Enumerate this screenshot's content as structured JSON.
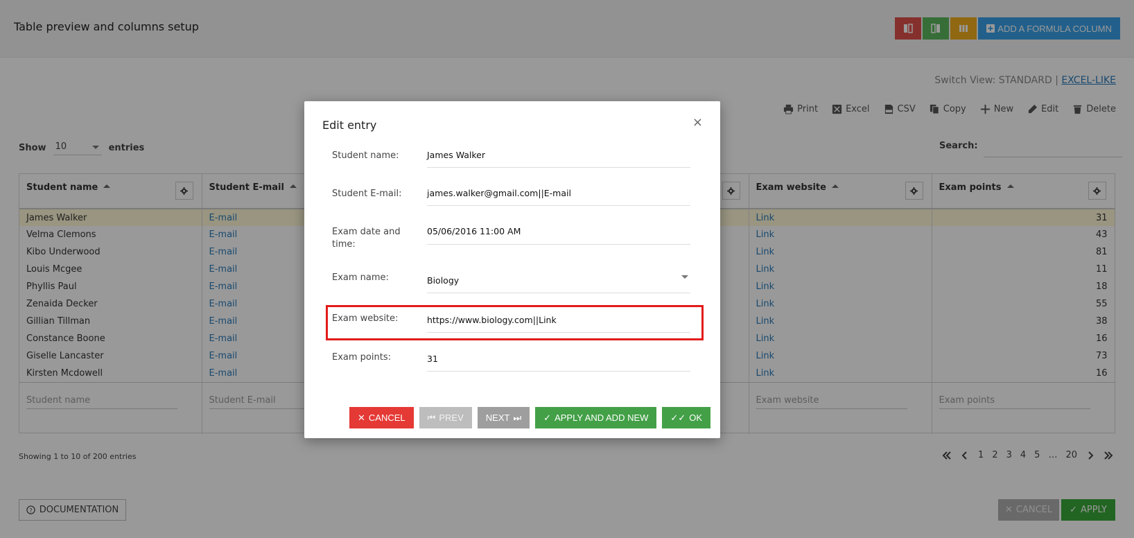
{
  "header": {
    "title": "Table preview and columns setup",
    "formula_button": "ADD A FORMULA COLUMN",
    "icons": [
      "column-remove-icon",
      "column-add-icon",
      "columns-icon",
      "plus-box-icon"
    ]
  },
  "switch_view": {
    "prefix": "Switch View: STANDARD |",
    "link": "EXCEL-LIKE"
  },
  "tools": {
    "print": "Print",
    "excel": "Excel",
    "csv": "CSV",
    "copy": "Copy",
    "new": "New",
    "edit": "Edit",
    "delete": "Delete"
  },
  "show": {
    "label": "Show",
    "value": "10",
    "suffix": "entries"
  },
  "search": {
    "label": "Search:"
  },
  "table": {
    "columns": [
      "Student name",
      "Student E-mail",
      "",
      "",
      "Exam website",
      "Exam points"
    ],
    "rows": [
      {
        "name": "James Walker",
        "email": "E-mail",
        "website": "Link",
        "points": "31"
      },
      {
        "name": "Velma Clemons",
        "email": "E-mail",
        "website": "Link",
        "points": "43"
      },
      {
        "name": "Kibo Underwood",
        "email": "E-mail",
        "website": "Link",
        "points": "81"
      },
      {
        "name": "Louis Mcgee",
        "email": "E-mail",
        "website": "Link",
        "points": "11"
      },
      {
        "name": "Phyllis Paul",
        "email": "E-mail",
        "website": "Link",
        "points": "18"
      },
      {
        "name": "Zenaida Decker",
        "email": "E-mail",
        "website": "Link",
        "points": "55"
      },
      {
        "name": "Gillian Tillman",
        "email": "E-mail",
        "website": "Link",
        "points": "38"
      },
      {
        "name": "Constance Boone",
        "email": "E-mail",
        "website": "Link",
        "points": "16"
      },
      {
        "name": "Giselle Lancaster",
        "email": "E-mail",
        "website": "Link",
        "points": "73"
      },
      {
        "name": "Kirsten Mcdowell",
        "email": "E-mail",
        "website": "Link",
        "points": "16"
      }
    ],
    "footer_placeholders": [
      "Student name",
      "Student E-mail",
      "",
      "",
      "Exam website",
      "Exam points"
    ]
  },
  "info": "Showing 1 to 10 of 200 entries",
  "pagination": {
    "pages": [
      "1",
      "2",
      "3",
      "4",
      "5",
      "…",
      "20"
    ]
  },
  "bottom": {
    "documentation": "DOCUMENTATION",
    "cancel": "CANCEL",
    "apply": "APPLY"
  },
  "modal": {
    "title": "Edit entry",
    "close": "×",
    "fields": [
      {
        "label": "Student name:",
        "value": "James Walker"
      },
      {
        "label": "Student E-mail:",
        "value": "james.walker@gmail.com||E-mail"
      },
      {
        "label": "Exam date and time:",
        "value": "05/06/2016 11:00 AM"
      },
      {
        "label": "Exam name:",
        "value": "Biology"
      },
      {
        "label": "Exam website:",
        "value": "https://www.biology.com||Link"
      },
      {
        "label": "Exam points:",
        "value": "31"
      }
    ],
    "buttons": {
      "cancel": "CANCEL",
      "prev": "PREV",
      "next": "NEXT",
      "apply_new": "APPLY AND ADD NEW",
      "ok": "OK"
    }
  },
  "colors": {
    "highlight": "#e31b1b",
    "primary": "#3aa0e8",
    "success": "#43a047",
    "danger": "#e53935"
  }
}
